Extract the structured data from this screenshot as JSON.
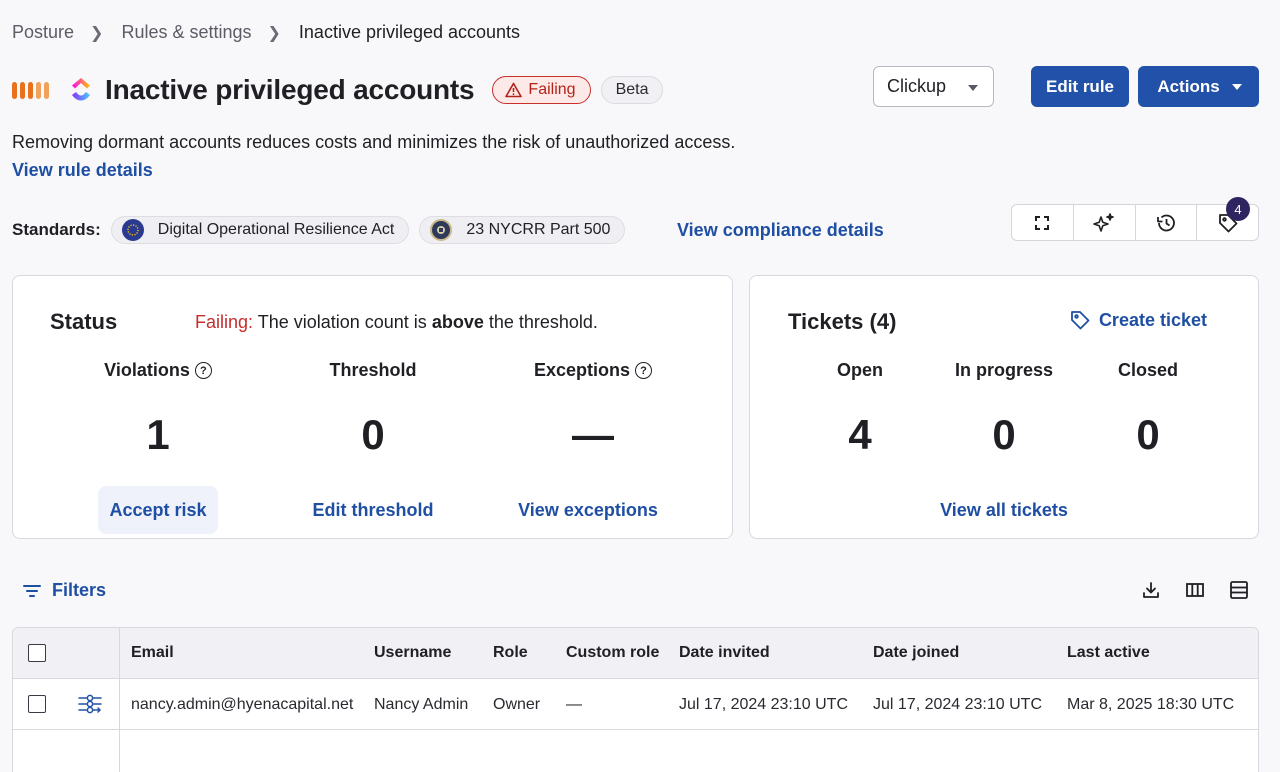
{
  "breadcrumb": {
    "items": [
      "Posture",
      "Rules & settings",
      "Inactive privileged accounts"
    ]
  },
  "header": {
    "title": "Inactive privileged accounts",
    "status_badge": "Failing",
    "beta_badge": "Beta",
    "app_select": "Clickup",
    "edit_rule": "Edit rule",
    "actions": "Actions"
  },
  "description": "Removing dormant accounts reduces costs and minimizes the risk of unauthorized access.",
  "view_rule_details": "View rule details",
  "standards": {
    "label": "Standards:",
    "items": [
      "Digital Operational Resilience Act",
      "23 NYCRR Part 500"
    ],
    "view_compliance": "View compliance details"
  },
  "toolbar_icons": {
    "tags_count": "4"
  },
  "status_card": {
    "title": "Status",
    "message_prefix": "Failing:",
    "message_mid": " The violation count is ",
    "message_bold": "above",
    "message_suffix": " the threshold.",
    "metrics": [
      {
        "label": "Violations",
        "value": "1",
        "action": "Accept risk"
      },
      {
        "label": "Threshold",
        "value": "0",
        "action": "Edit threshold"
      },
      {
        "label": "Exceptions",
        "value": "—",
        "action": "View exceptions"
      }
    ]
  },
  "tickets_card": {
    "title": "Tickets (4)",
    "create": "Create ticket",
    "metrics": [
      {
        "label": "Open",
        "value": "4"
      },
      {
        "label": "In progress",
        "value": "0"
      },
      {
        "label": "Closed",
        "value": "0"
      }
    ],
    "view_all": "View all tickets"
  },
  "filters": {
    "label": "Filters"
  },
  "table": {
    "columns": [
      "Email",
      "Username",
      "Role",
      "Custom role",
      "Date invited",
      "Date joined",
      "Last active"
    ],
    "rows": [
      {
        "email": "nancy.admin@hyenacapital.net",
        "username": "Nancy Admin",
        "role": "Owner",
        "custom_role": "—",
        "date_invited": "Jul 17, 2024 23:10 UTC",
        "date_joined": "Jul 17, 2024 23:10 UTC",
        "last_active": "Mar 8, 2025 18:30 UTC"
      }
    ]
  },
  "colors": {
    "primary": "#2151a8",
    "link": "#1f4fa3",
    "failing": "#c62e2e",
    "severity": "#e8711c"
  }
}
